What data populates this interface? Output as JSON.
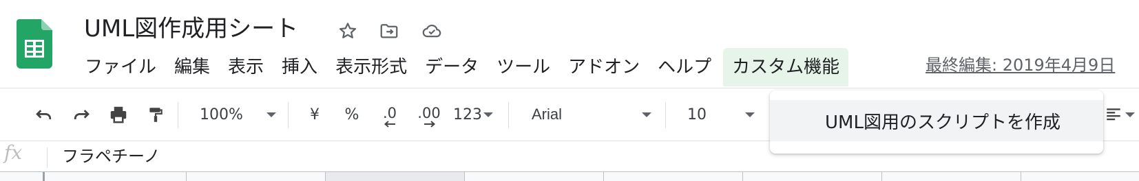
{
  "app": {
    "document_title": "UML図作成用シート",
    "last_edit": "最終編集: 2019年4月9日"
  },
  "menu": [
    {
      "label": "ファイル"
    },
    {
      "label": "編集"
    },
    {
      "label": "表示"
    },
    {
      "label": "挿入"
    },
    {
      "label": "表示形式"
    },
    {
      "label": "データ"
    },
    {
      "label": "ツール"
    },
    {
      "label": "アドオン"
    },
    {
      "label": "ヘルプ"
    },
    {
      "label": "カスタム機能",
      "active": true
    }
  ],
  "toolbar": {
    "zoom": "100%",
    "currency": "¥",
    "percent": "%",
    "decrease_decimal": ".0",
    "increase_decimal": ".00",
    "more_formats": "123",
    "font_family": "Arial",
    "font_size": "10"
  },
  "formula_bar": {
    "fx_label": "fx",
    "value": "フラペチーノ"
  },
  "custom_menu": {
    "items": [
      {
        "label": "UML図用のスクリプトを作成"
      }
    ]
  },
  "colors": {
    "sheets_green": "#23a566",
    "active_menu_bg": "#e6f4ea",
    "icon_gray": "#5f6368"
  }
}
